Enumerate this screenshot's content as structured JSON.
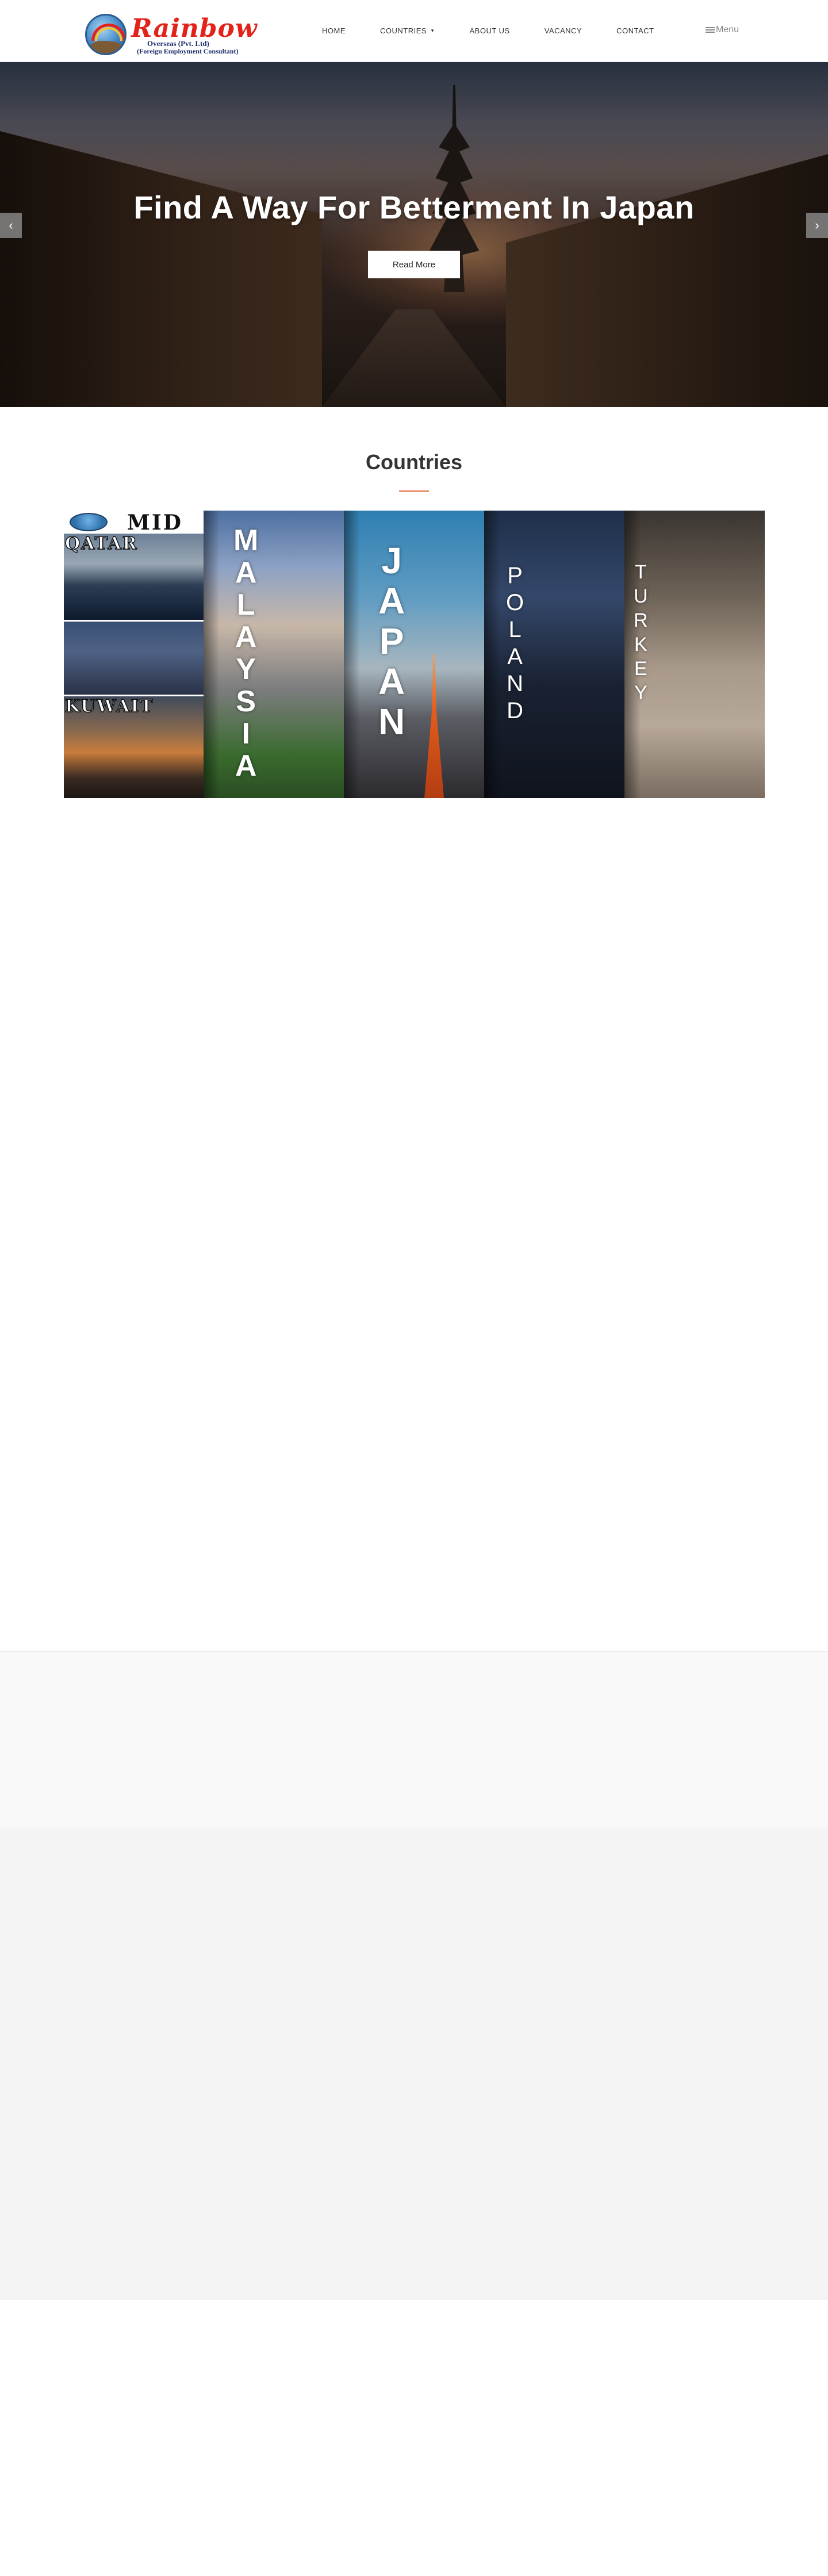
{
  "header": {
    "logo": {
      "name": "Rainbow",
      "line1": "Overseas (Pvt. Ltd)",
      "line2": "(Foreign Employment Consultant)"
    },
    "nav": [
      {
        "label": "HOME"
      },
      {
        "label": "COUNTRIES",
        "has_dropdown": true
      },
      {
        "label": "ABOUT US"
      },
      {
        "label": "VACANCY"
      },
      {
        "label": "CONTACT"
      }
    ],
    "menu_label": "Menu"
  },
  "hero": {
    "title": "Find A Way For Betterment In Japan",
    "button_label": "Read More",
    "prev_icon": "‹",
    "next_icon": "›"
  },
  "countries": {
    "title": "Countries",
    "accent_color": "#e5683c",
    "middle_east": {
      "top_text": "MID",
      "qatar": "QATAR",
      "kuwait": "KUWAIT"
    },
    "tiles": [
      {
        "name": "MALAYSIA",
        "letters": [
          "M",
          "A",
          "L",
          "A",
          "Y",
          "S",
          "I",
          "A"
        ]
      },
      {
        "name": "JAPAN",
        "letters": [
          "J",
          "A",
          "P",
          "A",
          "N"
        ]
      },
      {
        "name": "POLAND",
        "letters": [
          "P",
          "O",
          "L",
          "A",
          "N",
          "D"
        ]
      },
      {
        "name": "TURKEY",
        "letters": [
          "T",
          "U",
          "R",
          "K",
          "E",
          "Y"
        ]
      }
    ]
  }
}
